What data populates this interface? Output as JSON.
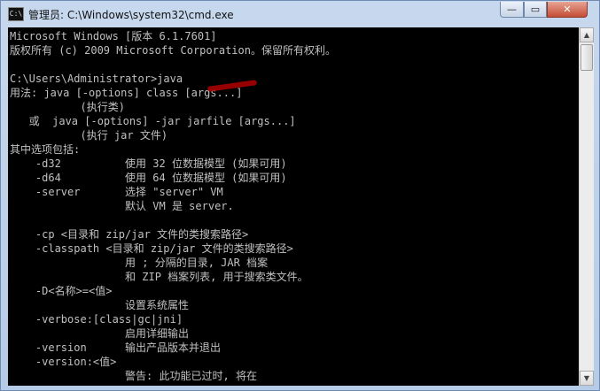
{
  "window": {
    "icon_text": "C:\\",
    "title": "管理员: C:\\Windows\\system32\\cmd.exe",
    "minimize_glyph": "—",
    "maximize_glyph": "▭",
    "close_glyph": "✕"
  },
  "console": {
    "lines": [
      "Microsoft Windows [版本 6.1.7601]",
      "版权所有 (c) 2009 Microsoft Corporation。保留所有权利。",
      "",
      "C:\\Users\\Administrator>java",
      "用法: java [-options] class [args...]",
      "           (执行类)",
      "   或  java [-options] -jar jarfile [args...]",
      "           (执行 jar 文件)",
      "其中选项包括:",
      "    -d32          使用 32 位数据模型 (如果可用)",
      "    -d64          使用 64 位数据模型 (如果可用)",
      "    -server       选择 \"server\" VM",
      "                  默认 VM 是 server.",
      "",
      "    -cp <目录和 zip/jar 文件的类搜索路径>",
      "    -classpath <目录和 zip/jar 文件的类搜索路径>",
      "                  用 ; 分隔的目录, JAR 档案",
      "                  和 ZIP 档案列表, 用于搜索类文件。",
      "    -D<名称>=<值>",
      "                  设置系统属性",
      "    -verbose:[class|gc|jni]",
      "                  启用详细输出",
      "    -version      输出产品版本并退出",
      "    -version:<值>",
      "                  警告: 此功能已过时, 将在"
    ]
  },
  "scrollbar": {
    "up_glyph": "▲",
    "down_glyph": "▼"
  },
  "colors": {
    "console_background": "#000000",
    "console_text": "#c0c0c0",
    "annotation": "#b00000"
  }
}
